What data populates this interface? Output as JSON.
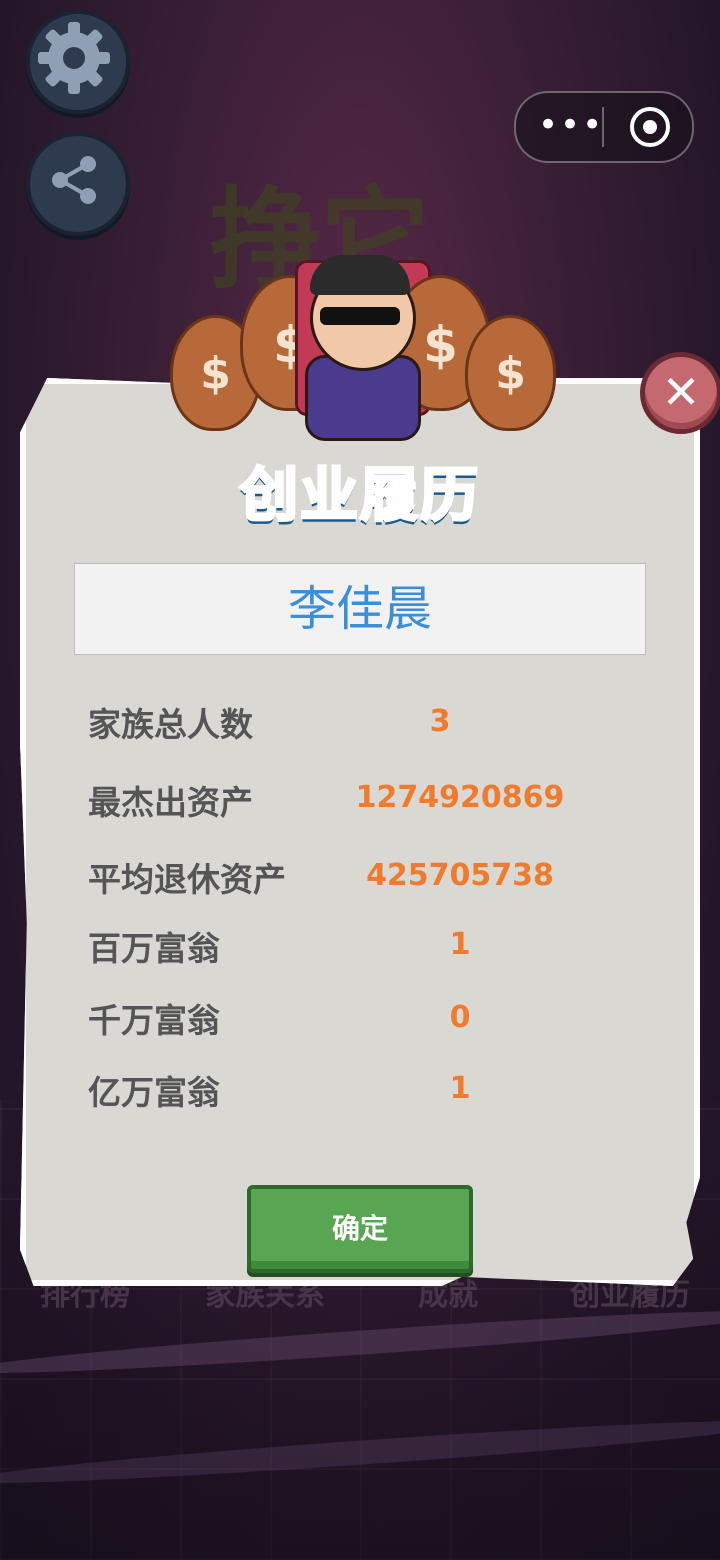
{
  "panel": {
    "title": "创业履历",
    "player_name": "李佳晨",
    "stats": [
      {
        "label": "家族总人数",
        "value": "3"
      },
      {
        "label": "最杰出资产",
        "value": "1274920869"
      },
      {
        "label": "平均退休资产",
        "value": "425705738"
      },
      {
        "label": "百万富翁",
        "value": "1"
      },
      {
        "label": "千万富翁",
        "value": "0"
      },
      {
        "label": "亿万富翁",
        "value": "1"
      }
    ],
    "confirm_label": "确定"
  },
  "background": {
    "title_partial": "挣它",
    "tabs": [
      "排行榜",
      "家族关系",
      "成就",
      "创业履历"
    ]
  },
  "hero": {
    "bag_symbol": "$"
  },
  "topbar": {
    "more_glyph": "•••",
    "close_glyph": "✕"
  },
  "colors": {
    "panel_bg": "#d9d8d3",
    "value_orange": "#ef7b2c",
    "name_blue": "#3b8fd8",
    "title_blue": "#2fa1e6",
    "confirm_green": "#58a651"
  }
}
